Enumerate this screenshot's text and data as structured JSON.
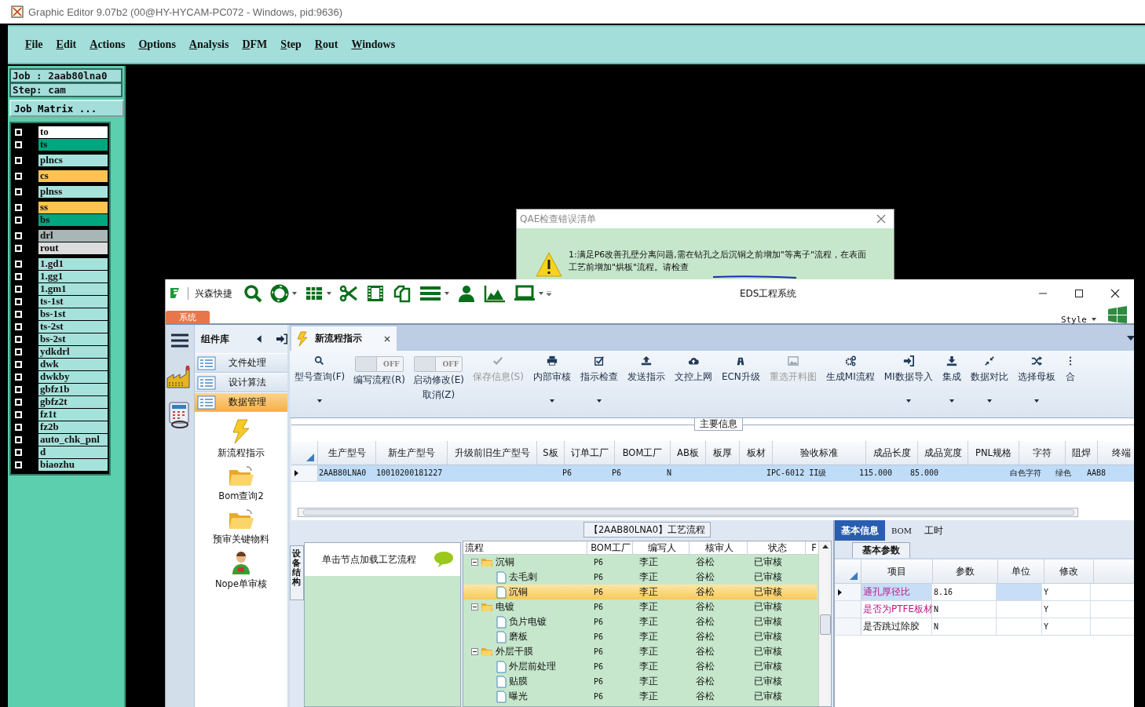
{
  "editor": {
    "title": "Graphic Editor 9.07b2 (00@HY-HYCAM-PC072 - Windows, pid:9636)",
    "menu": [
      "File",
      "Edit",
      "Actions",
      "Options",
      "Analysis",
      "DFM",
      "Step",
      "Rout",
      "Windows"
    ],
    "job": "Job : 2aab80lna0",
    "step": "Step: cam",
    "matrix_button": "Job Matrix ...",
    "layer_groups": [
      {
        "layers": [
          {
            "name": "to",
            "color": "#ffffff",
            "checked": false
          },
          {
            "name": "ts",
            "color": "#00a67e",
            "checked": false
          }
        ]
      },
      {
        "layers": [
          {
            "name": "plncs",
            "color": "#a6e2dc",
            "checked": false
          }
        ]
      },
      {
        "layers": [
          {
            "name": "cs",
            "color": "#ffc44e",
            "checked": false
          }
        ]
      },
      {
        "layers": [
          {
            "name": "plnss",
            "color": "#a6e2dc",
            "checked": false
          }
        ]
      },
      {
        "layers": [
          {
            "name": "ss",
            "color": "#ffc44e",
            "checked": false
          },
          {
            "name": "bs",
            "color": "#00a67e",
            "checked": false
          }
        ]
      },
      {
        "layers": [
          {
            "name": "drl",
            "color": "#a9b6b6",
            "checked": false
          },
          {
            "name": "rout",
            "color": "#dcdcdc",
            "checked": false
          }
        ]
      },
      {
        "layers": [
          {
            "name": "1.gd1",
            "color": "#a6e2dc",
            "checked": false
          },
          {
            "name": "1.gg1",
            "color": "#a6e2dc",
            "checked": false
          },
          {
            "name": "1.gm1",
            "color": "#a6e2dc",
            "checked": false
          },
          {
            "name": "ts-1st",
            "color": "#a6e2dc",
            "checked": false
          },
          {
            "name": "bs-1st",
            "color": "#a6e2dc",
            "checked": false
          },
          {
            "name": "ts-2st",
            "color": "#a6e2dc",
            "checked": false
          },
          {
            "name": "bs-2st",
            "color": "#a6e2dc",
            "checked": false
          },
          {
            "name": "ydkdrl",
            "color": "#a6e2dc",
            "checked": false
          },
          {
            "name": "dwk",
            "color": "#a6e2dc",
            "checked": false
          },
          {
            "name": "dwkby",
            "color": "#a6e2dc",
            "checked": false
          },
          {
            "name": "gbfz1b",
            "color": "#a6e2dc",
            "checked": false
          },
          {
            "name": "gbfz2t",
            "color": "#a6e2dc",
            "checked": false
          },
          {
            "name": "fz1t",
            "color": "#a6e2dc",
            "checked": false
          },
          {
            "name": "fz2b",
            "color": "#a6e2dc",
            "checked": false
          },
          {
            "name": "auto_chk_pnl",
            "color": "#a6e2dc",
            "checked": false
          },
          {
            "name": "d",
            "color": "#a6e2dc",
            "checked": false
          },
          {
            "name": "biaozhu",
            "color": "#a6e2dc",
            "checked": false
          }
        ]
      }
    ]
  },
  "qae_dialog": {
    "title": "QAE检查错误清单",
    "message": "1:满足P6改善孔壁分离问题,需在钻孔之后沉铜之前增加\"等离子\"流程，在表面工艺前增加\"烘板\"流程。请检查"
  },
  "eds": {
    "brand": "兴森快捷",
    "title": "EDS工程系统",
    "system_tab": "系统",
    "style_menu": "Style",
    "library": {
      "title": "组件库",
      "categories": [
        {
          "label": "文件处理",
          "selected": false
        },
        {
          "label": "设计算法",
          "selected": false
        },
        {
          "label": "数据管理",
          "selected": true
        }
      ],
      "tools": [
        "新流程指示",
        "Bom查询2",
        "预审关键物料",
        "Nope单审核"
      ]
    },
    "doc_tab": "新流程指示",
    "ribbon": [
      {
        "kind": "button",
        "label": "型号查询(F)",
        "disabled": false,
        "dropdown": true
      },
      {
        "kind": "toggle",
        "switch": "OFF",
        "on": false,
        "label": "编写流程(R)"
      },
      {
        "kind": "toggle",
        "switch": "OFF",
        "on": false,
        "label": "启动修改(E)",
        "sublabel": "取消(Z)"
      },
      {
        "kind": "button",
        "label": "保存信息(S)",
        "disabled": true,
        "dropdown": false
      },
      {
        "kind": "button",
        "label": "内部审核",
        "disabled": false,
        "dropdown": true
      },
      {
        "kind": "button",
        "label": "指示检查",
        "disabled": false,
        "dropdown": true
      },
      {
        "kind": "button",
        "label": "发送指示",
        "disabled": false,
        "dropdown": false
      },
      {
        "kind": "button",
        "label": "文控上网",
        "disabled": false,
        "dropdown": false
      },
      {
        "kind": "button",
        "label": "ECN升级",
        "disabled": false,
        "dropdown": false
      },
      {
        "kind": "button",
        "label": "重选开料图",
        "disabled": true,
        "dropdown": false
      },
      {
        "kind": "button",
        "label": "生成MI流程",
        "disabled": false,
        "dropdown": false
      },
      {
        "kind": "button",
        "label": "MI数据导入",
        "disabled": false,
        "dropdown": true
      },
      {
        "kind": "button",
        "label": "集成",
        "disabled": false,
        "dropdown": true
      },
      {
        "kind": "button",
        "label": "数据对比",
        "disabled": false,
        "dropdown": true
      },
      {
        "kind": "button",
        "label": "选择母板",
        "disabled": false,
        "dropdown": true
      },
      {
        "kind": "button",
        "label": "合",
        "disabled": false,
        "dropdown": false
      }
    ],
    "main_info": {
      "title": "主要信息",
      "columns": [
        "生产型号",
        "新生产型号",
        "升级前旧生产型号",
        "S板",
        "订单工厂",
        "BOM工厂",
        "AB板",
        "板厚",
        "板材",
        "验收标准",
        "成品长度",
        "成品宽度",
        "PNL规格",
        "字符",
        "阻焊",
        "终端"
      ],
      "rows": [
        {
          "selected": true,
          "cells": [
            "2AAB80LNA0",
            "10010200181227",
            null,
            null,
            "P6",
            "P6",
            "N",
            null,
            null,
            "IPC-6012 II级",
            "115.000",
            "85.000",
            null,
            "白色字符",
            "绿色",
            "AAB8"
          ]
        }
      ]
    },
    "flow": {
      "title": "【2AAB80LNA0】工艺流程",
      "side_tab": "设备结构",
      "hint": "单击节点加载工艺流程",
      "columns": [
        "流程",
        "BOM工厂",
        "编写人",
        "核审人",
        "状态",
        "F"
      ],
      "nodes": [
        {
          "name": "沉铜",
          "expanded": true,
          "selected": false,
          "cells": [
            "P6",
            "李正",
            "谷松",
            "已审核"
          ],
          "children": [
            {
              "name": "去毛刺",
              "selected": false,
              "cells": [
                "P6",
                "李正",
                "谷松",
                "已审核"
              ]
            },
            {
              "name": "沉铜",
              "selected": true,
              "cells": [
                "P6",
                "李正",
                "谷松",
                "已审核"
              ]
            }
          ]
        },
        {
          "name": "电镀",
          "expanded": true,
          "selected": false,
          "cells": [
            "P6",
            "李正",
            "谷松",
            "已审核"
          ],
          "children": [
            {
              "name": "负片电镀",
              "selected": false,
              "cells": [
                "P6",
                "李正",
                "谷松",
                "已审核"
              ]
            },
            {
              "name": "磨板",
              "selected": false,
              "cells": [
                "P6",
                "李正",
                "谷松",
                "已审核"
              ]
            }
          ]
        },
        {
          "name": "外层干膜",
          "expanded": true,
          "selected": false,
          "cells": [
            "P6",
            "李正",
            "谷松",
            "已审核"
          ],
          "children": [
            {
              "name": "外层前处理",
              "selected": false,
              "cells": [
                "P6",
                "李正",
                "谷松",
                "已审核"
              ]
            },
            {
              "name": "贴膜",
              "selected": false,
              "cells": [
                "P6",
                "李正",
                "谷松",
                "已审核"
              ]
            },
            {
              "name": "曝光",
              "selected": false,
              "cells": [
                "P6",
                "李正",
                "谷松",
                "已审核"
              ]
            }
          ]
        }
      ]
    },
    "details": {
      "tabs": [
        {
          "label": "基本信息",
          "selected": true
        },
        {
          "label": "BOM",
          "selected": false
        },
        {
          "label": "工时",
          "selected": false
        }
      ],
      "subtab": "基本参数",
      "columns": [
        "项目",
        "参数",
        "单位",
        "修改"
      ],
      "rows": [
        {
          "item": "通孔厚径比",
          "value": "8.16",
          "modify": "Y",
          "flagged": true,
          "selected": true
        },
        {
          "item": "是否为PTFE板材",
          "value": "N",
          "modify": "Y",
          "flagged": true,
          "selected": false
        },
        {
          "item": "是否跳过除胶",
          "value": "N",
          "modify": "Y",
          "flagged": false,
          "selected": false
        }
      ]
    }
  }
}
